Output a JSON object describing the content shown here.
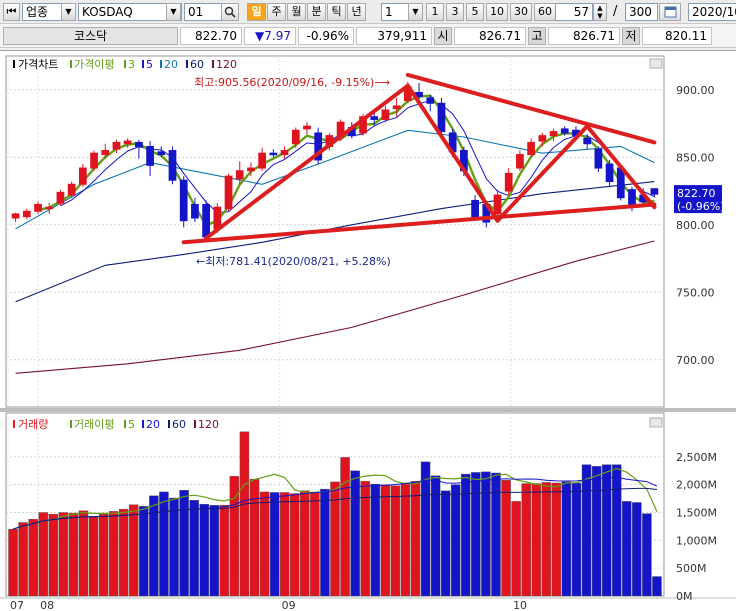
{
  "toolbar": {
    "market_value": "업종",
    "index_value": "KOSDAQ",
    "code_value": "01",
    "search_icon": "magnifier-icon",
    "periods": [
      "일",
      "주",
      "월",
      "분",
      "틱",
      "년"
    ],
    "active_period": "일",
    "interval_value": "1",
    "intervals": [
      "1",
      "3",
      "5",
      "10",
      "30",
      "60"
    ],
    "count_value": "57",
    "separator": "/",
    "total_value": "300",
    "date_value": "2020/10/"
  },
  "quote": {
    "name": "코스닥",
    "price": "822.70",
    "change": "▼7.97",
    "change_pct": "-0.96%",
    "volume": "379,911",
    "open_label": "시",
    "open": "826.71",
    "high_label": "고",
    "high": "826.71",
    "low_label": "저",
    "low": "820.11"
  },
  "colors": {
    "up": "#e0141e",
    "down": "#1414c8",
    "ma3": "#64a014",
    "ma5": "#1414c8",
    "ma20": "#0f78b4",
    "ma60": "#0f1e78",
    "ma120": "#780f2d",
    "trend": "#dc1e1e",
    "price_box": "#1414c8"
  },
  "chart_data": {
    "type": "candlestick",
    "price_panel": {
      "title": "가격차트",
      "legend": [
        {
          "label": "가격이평",
          "color": "#64a014"
        },
        {
          "label": "3",
          "color": "#64a014"
        },
        {
          "label": "5",
          "color": "#1414c8"
        },
        {
          "label": "20",
          "color": "#0f78b4"
        },
        {
          "label": "60",
          "color": "#0f1e78"
        },
        {
          "label": "120",
          "color": "#780f2d"
        }
      ],
      "ylim": [
        665,
        925
      ],
      "yticks": [
        {
          "v": 900,
          "label": "900.00"
        },
        {
          "v": 850,
          "label": "850.00"
        },
        {
          "v": 800,
          "label": "800.00"
        },
        {
          "v": 750,
          "label": "750.00"
        },
        {
          "v": 700,
          "label": "700.00"
        }
      ],
      "candles": [
        {
          "o": 805,
          "h": 809,
          "l": 802,
          "c": 808
        },
        {
          "o": 806,
          "h": 812,
          "l": 804,
          "c": 810
        },
        {
          "o": 810,
          "h": 817,
          "l": 808,
          "c": 815
        },
        {
          "o": 812,
          "h": 816,
          "l": 808,
          "c": 813
        },
        {
          "o": 816,
          "h": 826,
          "l": 814,
          "c": 824
        },
        {
          "o": 822,
          "h": 832,
          "l": 820,
          "c": 830
        },
        {
          "o": 830,
          "h": 845,
          "l": 828,
          "c": 842
        },
        {
          "o": 842,
          "h": 855,
          "l": 840,
          "c": 853
        },
        {
          "o": 852,
          "h": 860,
          "l": 849,
          "c": 855
        },
        {
          "o": 856,
          "h": 863,
          "l": 853,
          "c": 861
        },
        {
          "o": 860,
          "h": 864,
          "l": 857,
          "c": 862
        },
        {
          "o": 861,
          "h": 863,
          "l": 849,
          "c": 858
        },
        {
          "o": 858,
          "h": 862,
          "l": 836,
          "c": 844
        },
        {
          "o": 854,
          "h": 858,
          "l": 850,
          "c": 852
        },
        {
          "o": 855,
          "h": 858,
          "l": 830,
          "c": 833
        },
        {
          "o": 833,
          "h": 836,
          "l": 798,
          "c": 803
        },
        {
          "o": 815,
          "h": 820,
          "l": 802,
          "c": 805
        },
        {
          "o": 815,
          "h": 818,
          "l": 788,
          "c": 791
        },
        {
          "o": 797,
          "h": 816,
          "l": 794,
          "c": 813
        },
        {
          "o": 812,
          "h": 838,
          "l": 810,
          "c": 836
        },
        {
          "o": 834,
          "h": 847,
          "l": 830,
          "c": 840
        },
        {
          "o": 840,
          "h": 846,
          "l": 836,
          "c": 842
        },
        {
          "o": 842,
          "h": 857,
          "l": 840,
          "c": 853
        },
        {
          "o": 853,
          "h": 856,
          "l": 850,
          "c": 852
        },
        {
          "o": 852,
          "h": 858,
          "l": 849,
          "c": 855
        },
        {
          "o": 860,
          "h": 872,
          "l": 857,
          "c": 870
        },
        {
          "o": 871,
          "h": 876,
          "l": 867,
          "c": 873
        },
        {
          "o": 868,
          "h": 872,
          "l": 845,
          "c": 848
        },
        {
          "o": 858,
          "h": 868,
          "l": 855,
          "c": 866
        },
        {
          "o": 865,
          "h": 878,
          "l": 862,
          "c": 876
        },
        {
          "o": 872,
          "h": 876,
          "l": 864,
          "c": 866
        },
        {
          "o": 868,
          "h": 882,
          "l": 866,
          "c": 880
        },
        {
          "o": 880,
          "h": 884,
          "l": 874,
          "c": 878
        },
        {
          "o": 878,
          "h": 888,
          "l": 876,
          "c": 885
        },
        {
          "o": 886,
          "h": 894,
          "l": 880,
          "c": 888
        },
        {
          "o": 892,
          "h": 906,
          "l": 890,
          "c": 902
        },
        {
          "o": 898,
          "h": 905,
          "l": 890,
          "c": 895
        },
        {
          "o": 894,
          "h": 896,
          "l": 884,
          "c": 890
        },
        {
          "o": 890,
          "h": 894,
          "l": 866,
          "c": 869
        },
        {
          "o": 868,
          "h": 871,
          "l": 850,
          "c": 854
        },
        {
          "o": 855,
          "h": 858,
          "l": 836,
          "c": 840
        },
        {
          "o": 818,
          "h": 822,
          "l": 803,
          "c": 806
        },
        {
          "o": 815,
          "h": 818,
          "l": 798,
          "c": 802
        },
        {
          "o": 808,
          "h": 826,
          "l": 805,
          "c": 822
        },
        {
          "o": 825,
          "h": 842,
          "l": 822,
          "c": 838
        },
        {
          "o": 842,
          "h": 855,
          "l": 840,
          "c": 852
        },
        {
          "o": 852,
          "h": 864,
          "l": 850,
          "c": 861
        },
        {
          "o": 862,
          "h": 868,
          "l": 858,
          "c": 866
        },
        {
          "o": 866,
          "h": 871,
          "l": 862,
          "c": 869
        },
        {
          "o": 871,
          "h": 873,
          "l": 866,
          "c": 868
        },
        {
          "o": 870,
          "h": 873,
          "l": 863,
          "c": 866
        },
        {
          "o": 864,
          "h": 867,
          "l": 856,
          "c": 860
        },
        {
          "o": 856,
          "h": 858,
          "l": 839,
          "c": 842
        },
        {
          "o": 845,
          "h": 848,
          "l": 828,
          "c": 832
        },
        {
          "o": 842,
          "h": 845,
          "l": 818,
          "c": 820
        },
        {
          "o": 826,
          "h": 828,
          "l": 810,
          "c": 813
        },
        {
          "o": 822,
          "h": 827,
          "l": 815,
          "c": 817
        },
        {
          "o": 826.71,
          "h": 826.71,
          "l": 820.11,
          "c": 822.7
        }
      ],
      "ma_lines": [
        {
          "name": "20",
          "color": "#0f78b4",
          "pts": [
            [
              0,
              797
            ],
            [
              7,
              830
            ],
            [
              12,
              846
            ],
            [
              17,
              838
            ],
            [
              22,
              830
            ],
            [
              28,
              848
            ],
            [
              35,
              870
            ],
            [
              40,
              865
            ],
            [
              47,
              853
            ],
            [
              54,
              858
            ],
            [
              57,
              846
            ]
          ]
        },
        {
          "name": "60",
          "color": "#0f1e78",
          "pts": [
            [
              0,
              743
            ],
            [
              8,
              770
            ],
            [
              15,
              778
            ],
            [
              22,
              787
            ],
            [
              30,
              800
            ],
            [
              38,
              812
            ],
            [
              47,
              823
            ],
            [
              57,
              832
            ]
          ]
        },
        {
          "name": "120",
          "color": "#780f2d",
          "pts": [
            [
              0,
              690
            ],
            [
              10,
              697
            ],
            [
              20,
              707
            ],
            [
              30,
              724
            ],
            [
              40,
              748
            ],
            [
              50,
              773
            ],
            [
              57,
              788
            ]
          ]
        }
      ],
      "trendlines": [
        {
          "from": [
            15,
            787
          ],
          "to": [
            57,
            815
          ]
        },
        {
          "from": [
            35,
            911
          ],
          "to": [
            57,
            861
          ]
        },
        {
          "from": [
            17,
            790
          ],
          "to": [
            35,
            903
          ]
        },
        {
          "from": [
            35,
            903
          ],
          "to": [
            43,
            803
          ]
        },
        {
          "from": [
            43,
            803
          ],
          "to": [
            51,
            873
          ]
        },
        {
          "from": [
            51,
            873
          ],
          "to": [
            57,
            813
          ]
        }
      ],
      "annotations": {
        "high": {
          "label": "최고:905.56(2020/09/16, -9.15%)",
          "v": 905.56,
          "index": 35
        },
        "low": {
          "label": "최저:781.41(2020/08/21, +5.28%)",
          "v": 781.41,
          "index": 17
        }
      },
      "last_price": {
        "price": "822.70",
        "pct": "(-0.96%)",
        "v": 822.7
      }
    },
    "volume_panel": {
      "title": "거래량",
      "legend": [
        {
          "label": "거래이평",
          "color": "#64a014"
        },
        {
          "label": "5",
          "color": "#64a014"
        },
        {
          "label": "20",
          "color": "#1414c8"
        },
        {
          "label": "60",
          "color": "#0f1e78"
        },
        {
          "label": "120",
          "color": "#780f2d"
        }
      ],
      "unit": "M",
      "ylim": [
        0,
        3000
      ],
      "yticks": [
        {
          "v": 2500,
          "label": "2,500M"
        },
        {
          "v": 2000,
          "label": "2,000M"
        },
        {
          "v": 1500,
          "label": "1,500M"
        },
        {
          "v": 1000,
          "label": "1,000M"
        },
        {
          "v": 500,
          "label": "500M"
        },
        {
          "v": 0,
          "label": "0M"
        }
      ],
      "volumes": [
        1200,
        1320,
        1380,
        1500,
        1470,
        1500,
        1490,
        1530,
        1430,
        1470,
        1520,
        1560,
        1640,
        1610,
        1800,
        1870,
        1760,
        1900,
        1720,
        1650,
        1630,
        1630,
        2150,
        2950,
        2100,
        1870,
        1860,
        1860,
        1840,
        1890,
        1860,
        1920,
        2050,
        2490,
        2250,
        2060,
        2010,
        2000,
        1980,
        2030,
        2060,
        2410,
        2160,
        1890,
        2000,
        2190,
        2220,
        2230,
        2210,
        2080,
        1700,
        2020,
        2020,
        2040,
        2030,
        2050,
        2030,
        2360,
        2330,
        2360,
        2360,
        1700,
        1680,
        1480,
        350
      ]
    },
    "x_axis": {
      "labels": [
        {
          "index": 0,
          "text": "07"
        },
        {
          "index": 3,
          "text": "08"
        },
        {
          "index": 24,
          "text": "09"
        },
        {
          "index": 45,
          "text": "10"
        }
      ]
    }
  }
}
